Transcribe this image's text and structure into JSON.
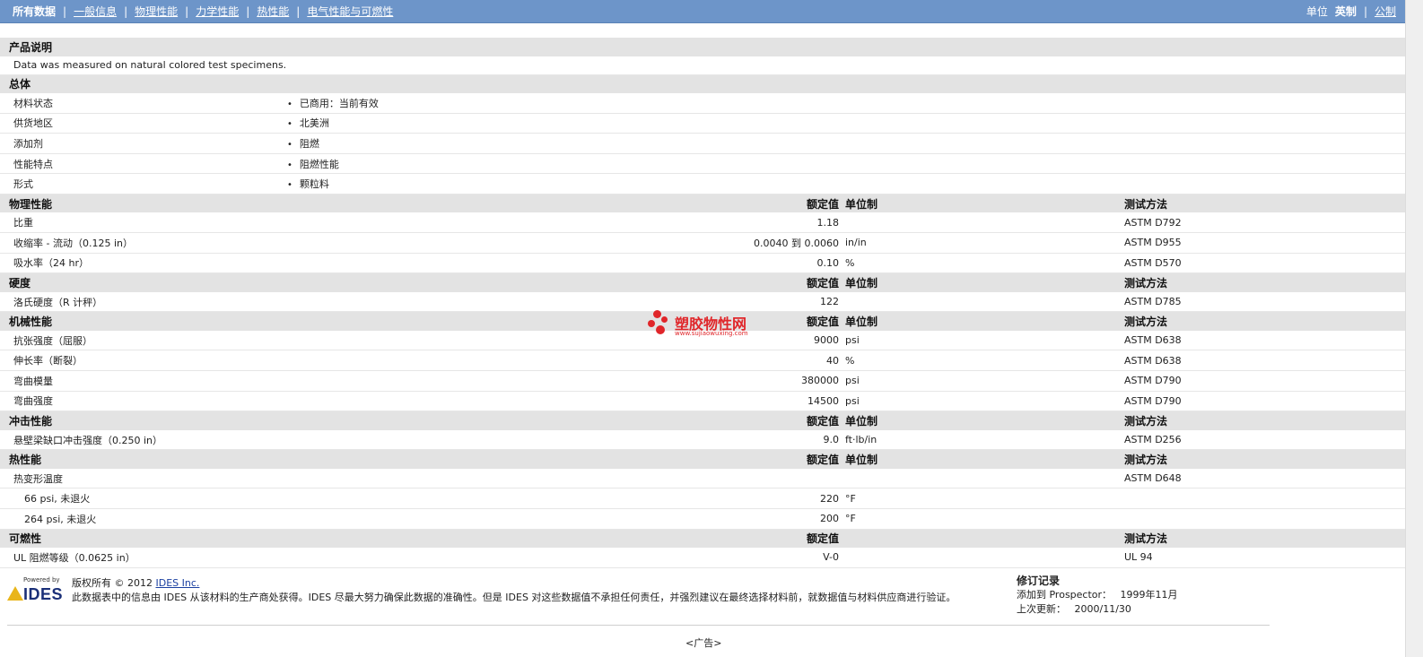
{
  "nav": {
    "items": [
      "所有数据",
      "一般信息",
      "物理性能",
      "力学性能",
      "热性能",
      "电气性能与可燃性"
    ],
    "unit_label": "单位",
    "unit_english": "英制",
    "unit_metric": "公制"
  },
  "description": {
    "title": "产品说明",
    "text": "Data was measured on natural colored test specimens."
  },
  "general": {
    "title": "总体",
    "rows": [
      {
        "label": "材料状态",
        "value": "已商用：当前有效"
      },
      {
        "label": "供货地区",
        "value": "北美洲"
      },
      {
        "label": "添加剂",
        "value": "阻燃"
      },
      {
        "label": "性能特点",
        "value": "阻燃性能"
      },
      {
        "label": "形式",
        "value": "颗粒料"
      }
    ]
  },
  "headers": {
    "nominal": "额定值",
    "unit": "单位制",
    "test": "测试方法"
  },
  "physical": {
    "title": "物理性能",
    "rows": [
      {
        "label": "比重",
        "value": "1.18",
        "unit": "",
        "test": "ASTM D792"
      },
      {
        "label": "收缩率 - 流动（0.125 in）",
        "value": "0.0040 到  0.0060",
        "unit": "in/in",
        "test": "ASTM D955"
      },
      {
        "label": "吸水率（24 hr）",
        "value": "0.10",
        "unit": "%",
        "test": "ASTM D570"
      }
    ]
  },
  "hardness": {
    "title": "硬度",
    "rows": [
      {
        "label": "洛氏硬度（R 计秤）",
        "value": "122",
        "unit": "",
        "test": "ASTM D785"
      }
    ]
  },
  "mechanical": {
    "title": "机械性能",
    "rows": [
      {
        "label": "抗张强度（屈服）",
        "value": "9000",
        "unit": "psi",
        "test": "ASTM D638"
      },
      {
        "label": "伸长率（断裂）",
        "value": "40",
        "unit": "%",
        "test": "ASTM D638"
      },
      {
        "label": "弯曲模量",
        "value": "380000",
        "unit": "psi",
        "test": "ASTM D790"
      },
      {
        "label": "弯曲强度",
        "value": "14500",
        "unit": "psi",
        "test": "ASTM D790"
      }
    ]
  },
  "impact": {
    "title": "冲击性能",
    "rows": [
      {
        "label": "悬壁梁缺口冲击强度（0.250 in）",
        "value": "9.0",
        "unit": "ft·lb/in",
        "test": "ASTM D256"
      }
    ]
  },
  "thermal": {
    "title": "热性能",
    "rows": [
      {
        "label": "热变形温度",
        "value": "",
        "unit": "",
        "test": "ASTM D648"
      },
      {
        "label": "66 psi, 未退火",
        "value": "220",
        "unit": "°F",
        "test": ""
      },
      {
        "label": "264 psi, 未退火",
        "value": "200",
        "unit": "°F",
        "test": ""
      }
    ]
  },
  "flammability": {
    "title": "可燃性",
    "rows": [
      {
        "label": "UL 阻燃等级（0.0625 in）",
        "value": "V-0",
        "unit": "",
        "test": "UL 94"
      }
    ]
  },
  "footer": {
    "powered_by": "Powered by",
    "logo_text": "IDES",
    "copyright": "版权所有 © 2012",
    "company_link": "IDES Inc.",
    "disclaimer": "此数据表中的信息由  IDES 从该材料的生产商处获得。IDES 尽最大努力确保此数据的准确性。但是  IDES 对这些数据值不承担任何责任，并强烈建议在最终选择材料前，就数据值与材料供应商进行验证。",
    "revision_title": "修订记录",
    "added_label": "添加到  Prospector：",
    "added_value": "1999年11月",
    "updated_label": "上次更新：",
    "updated_value": "2000/11/30",
    "ad": "<广告>"
  },
  "watermark": {
    "text": "塑胶物性网",
    "url": "www.sujiaowuxing.com"
  },
  "colors": {
    "nav_bg": "#6d95c9",
    "section_bg": "#e3e3e3",
    "watermark": "#e0262a"
  }
}
